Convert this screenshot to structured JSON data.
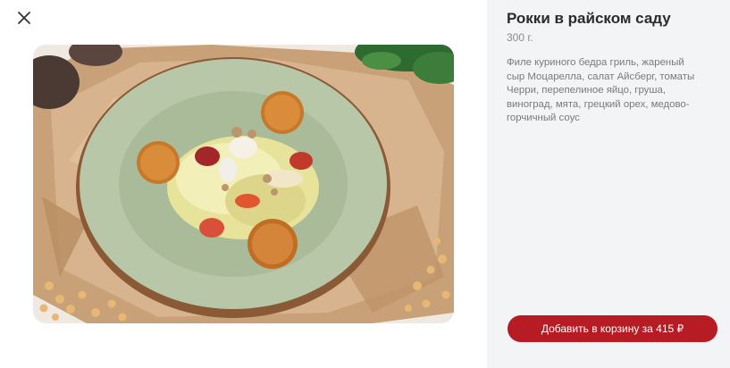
{
  "modal": {
    "title": "Рокки в райском саду",
    "weight": "300 г.",
    "description": "Филе куриного бедра гриль, жареный сыр Моцарелла, салат Айсберг, томаты Черри, перепелиное яйцо, груша, виноград, мята, грецкий орех, медово-горчичный соус",
    "add_to_cart_label": "Добавить в корзину за 415 ₽"
  },
  "icons": {
    "close": "close-icon",
    "photo": "dish-photo"
  },
  "colors": {
    "accent": "#b71c24",
    "side_panel": "#f3f4f6",
    "title": "#2b2b2b",
    "muted": "#7a7a7a"
  }
}
